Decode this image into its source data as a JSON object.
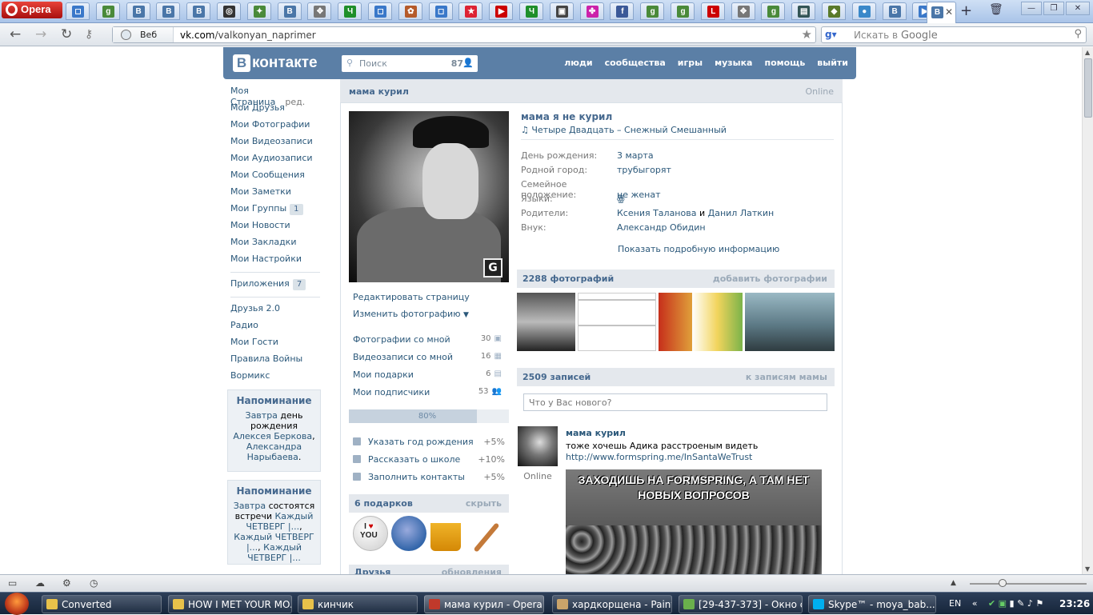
{
  "browser": {
    "app_name": "Opera",
    "active_tab_icon": "В",
    "address_label": "Веб",
    "url_domain": "vk.com",
    "url_path": "/valkonyan_naprimer",
    "search_placeholder_prefix": "Искать в",
    "search_engine": "Google",
    "tab_icons": [
      {
        "name": "chat-icon",
        "glyph": "◻",
        "color": "#3a78c9"
      },
      {
        "name": "google-icon",
        "glyph": "g",
        "color": "#4a8a3a"
      },
      {
        "name": "vk-icon",
        "glyph": "В",
        "color": "#4a76a8"
      },
      {
        "name": "vk-icon",
        "glyph": "В",
        "color": "#4a76a8"
      },
      {
        "name": "vk-icon",
        "glyph": "В",
        "color": "#4a76a8"
      },
      {
        "name": "steam-icon",
        "glyph": "◎",
        "color": "#333"
      },
      {
        "name": "network-icon",
        "glyph": "✦",
        "color": "#4a8a3a"
      },
      {
        "name": "vk-icon",
        "glyph": "В",
        "color": "#4a76a8"
      },
      {
        "name": "puzzle-icon",
        "glyph": "✥",
        "color": "#777"
      },
      {
        "name": "ichat-icon",
        "glyph": "Ч",
        "color": "#1f8f2a"
      },
      {
        "name": "chat-icon",
        "glyph": "◻",
        "color": "#3a78c9"
      },
      {
        "name": "flower-icon",
        "glyph": "✿",
        "color": "#b55a2a"
      },
      {
        "name": "chat-icon",
        "glyph": "◻",
        "color": "#3a78c9"
      },
      {
        "name": "star-icon",
        "glyph": "★",
        "color": "#d23"
      },
      {
        "name": "youtube-icon",
        "glyph": "▶",
        "color": "#c00"
      },
      {
        "name": "ichat-icon",
        "glyph": "Ч",
        "color": "#1f8f2a"
      },
      {
        "name": "image-icon",
        "glyph": "▣",
        "color": "#444"
      },
      {
        "name": "colors-icon",
        "glyph": "✤",
        "color": "#c2a"
      },
      {
        "name": "facebook-icon",
        "glyph": "f",
        "color": "#3b5998"
      },
      {
        "name": "google-icon",
        "glyph": "g",
        "color": "#4a8a3a"
      },
      {
        "name": "google-icon",
        "glyph": "g",
        "color": "#4a8a3a"
      },
      {
        "name": "l-icon",
        "glyph": "L",
        "color": "#c00"
      },
      {
        "name": "puzzle-icon",
        "glyph": "✥",
        "color": "#777"
      },
      {
        "name": "google-icon",
        "glyph": "g",
        "color": "#4a8a3a"
      },
      {
        "name": "monitor-icon",
        "glyph": "▤",
        "color": "#355"
      },
      {
        "name": "tank-icon",
        "glyph": "◆",
        "color": "#5a7a2a"
      },
      {
        "name": "drop-icon",
        "glyph": "●",
        "color": "#3a88c9"
      },
      {
        "name": "vk-icon",
        "glyph": "В",
        "color": "#4a76a8"
      },
      {
        "name": "play-icon",
        "glyph": "▶",
        "color": "#3a78c9"
      }
    ]
  },
  "vk": {
    "logo_letter": "В",
    "logo_text": "контакте",
    "search_placeholder": "Поиск",
    "search_count": "87",
    "nav": [
      "люди",
      "сообщества",
      "игры",
      "музыка",
      "помощь",
      "выйти"
    ]
  },
  "leftmenu": {
    "my_page": "Моя Страница",
    "edit": "ред.",
    "items": [
      {
        "label": "Мои Друзья"
      },
      {
        "label": "Мои Фотографии"
      },
      {
        "label": "Мои Видеозаписи"
      },
      {
        "label": "Мои Аудиозаписи"
      },
      {
        "label": "Мои Сообщения"
      },
      {
        "label": "Мои Заметки"
      },
      {
        "label": "Мои Группы",
        "badge": "1"
      },
      {
        "label": "Мои Новости"
      },
      {
        "label": "Мои Закладки"
      },
      {
        "label": "Мои Настройки"
      }
    ],
    "apps": {
      "label": "Приложения",
      "badge": "7"
    },
    "extra": [
      "Друзья 2.0",
      "Радио",
      "Мои Гости",
      "Правила Войны",
      "Вормикс"
    ]
  },
  "reminders": [
    {
      "title": "Напоминание",
      "pre": "Завтра",
      "text1": " день рождения ",
      "link1": "Алексея Беркова",
      "text2": ", ",
      "link2": "Александра Нарыбаева",
      "text3": "."
    },
    {
      "title": "Напоминание",
      "pre": "Завтра",
      "text1": " состоятся встречи ",
      "link1": "Каждый ЧЕТВЕРГ |...",
      "text2": ", ",
      "link2": "Каждый ЧЕТВЕРГ |...",
      "text3": ", ",
      "link3": "Каждый ЧЕТВЕРГ |..."
    }
  ],
  "profile": {
    "header_name": "мама курил",
    "online": "Online",
    "full_name": "мама я не курил",
    "status_song": "Четыре Двадцать – Снежный Смешанный",
    "info": [
      {
        "key": "День рождения:",
        "value": "3 марта"
      },
      {
        "key": "Родной город:",
        "value": "трубыгорят"
      },
      {
        "key": "Семейное положение:",
        "value": "не женат"
      },
      {
        "key": "Языки:",
        "value": "ꙮ"
      },
      {
        "key": "Родители:",
        "value": "Ксения Таланова",
        "conj": " и ",
        "value2": "Данил Латкин"
      },
      {
        "key": "Внук:",
        "value": "Александр Обидин"
      }
    ],
    "more_info": "Показать подробную информацию",
    "actions": [
      "Редактировать страницу",
      "Изменить фотографию"
    ],
    "counters": [
      {
        "label": "Фотографии со мной",
        "count": "30",
        "icon": "camera-icon"
      },
      {
        "label": "Видеозаписи со мной",
        "count": "16",
        "icon": "film-icon"
      },
      {
        "label": "Мои подарки",
        "count": "6",
        "icon": "gift-icon"
      },
      {
        "label": "Мои подписчики",
        "count": "53",
        "icon": "people-icon"
      }
    ],
    "completeness": {
      "label": "80%",
      "value": 0.8
    },
    "tips": [
      {
        "label": "Указать год рождения",
        "plus": "+5%",
        "icon": "calendar-icon"
      },
      {
        "label": "Рассказать о школе",
        "plus": "+10%",
        "icon": "school-icon"
      },
      {
        "label": "Заполнить контакты",
        "plus": "+5%",
        "icon": "phone-icon"
      }
    ],
    "gifts_head": {
      "label": "6 подарков",
      "action": "скрыть"
    },
    "friends_head": {
      "label": "Друзья",
      "action": "обновления"
    }
  },
  "photos": {
    "label": "2288 фотографий",
    "action": "добавить фотографии"
  },
  "wall": {
    "label": "2509 записей",
    "action": "к записям мамы",
    "input_placeholder": "Что у Вас нового?",
    "post": {
      "author": "мама курил",
      "text": "тоже хочешь Адика расстроеным видеть",
      "link": "http://www.formspring.me/InSantaWeTrust",
      "online": "Online",
      "image_caption": "ЗАХОДИШЬ НА FORMSPRING, А ТАМ НЕТ НОВЫХ ВОПРОСОВ"
    }
  },
  "taskbar": {
    "tasks": [
      {
        "label": "Converted",
        "color": "#e8c24a"
      },
      {
        "label": "HOW I MET YOUR MO...",
        "color": "#e8c24a"
      },
      {
        "label": "кинчик",
        "color": "#e8c24a"
      },
      {
        "label": "мама курил - Opera",
        "color": "#c0392b"
      },
      {
        "label": "хардкорщена - Paint",
        "color": "#caa46a"
      },
      {
        "label": "[29-437-373] - Окно с...",
        "color": "#6ab04c"
      },
      {
        "label": "Skype™ - moya_bab...",
        "color": "#00aff0"
      }
    ],
    "lang": "EN",
    "clock": "23:26"
  }
}
